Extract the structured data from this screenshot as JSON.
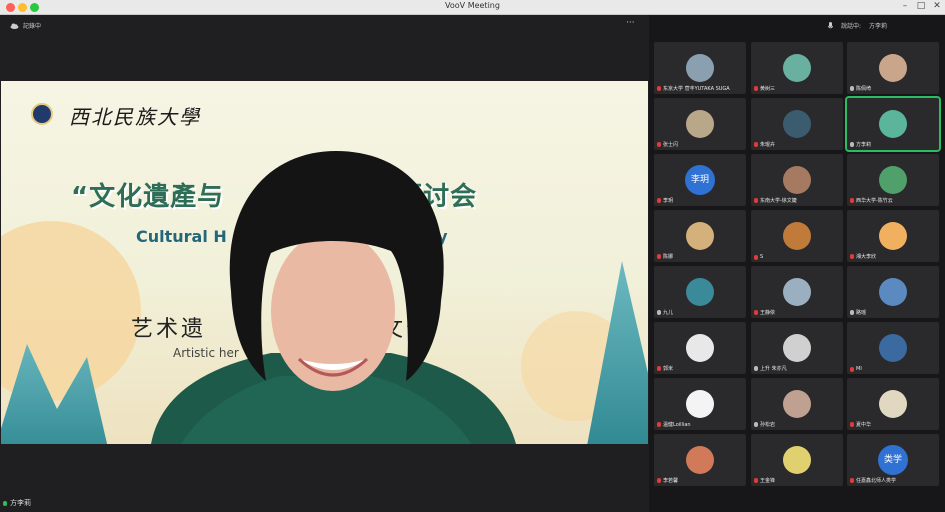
{
  "window": {
    "title": "VooV Meeting"
  },
  "toolbar": {
    "recording": "記錄中",
    "more": "···"
  },
  "sidebar_top": {
    "talking_label": "說話中:",
    "talking_name": "方李莉"
  },
  "slide": {
    "university": "西北民族大學",
    "title_cn": "“文化遺產与 　　　　学术研讨会",
    "title_en": "Cultural H　　　　　　　　　　pology",
    "subtitle_cn": "艺术遗　　　　　　　文化",
    "subtitle_en": "Artistic her"
  },
  "presenter_name": "方李莉",
  "participants": [
    {
      "name": "东京大学 菅丰YUTAKA SUGA",
      "avatar": "photo",
      "color": "#8aa0b0",
      "muted": true
    },
    {
      "name": "黄树三",
      "avatar": "photo",
      "color": "#6ab0a0",
      "muted": true
    },
    {
      "name": "陈佩绮",
      "avatar": "photo",
      "color": "#c9a58c",
      "muted": false
    },
    {
      "name": "张士闪",
      "avatar": "photo",
      "color": "#b9a78a",
      "muted": true
    },
    {
      "name": "朱琨卉",
      "avatar": "photo",
      "color": "#3b5c6e",
      "muted": true
    },
    {
      "name": "方李莉",
      "avatar": "photo",
      "color": "#5ab59a",
      "muted": false,
      "active": true
    },
    {
      "name": "李玥",
      "avatar": "text",
      "initials": "李玥",
      "color": "#2f72d3",
      "muted": true
    },
    {
      "name": "东南大学-徐文婕",
      "avatar": "photo",
      "color": "#a57a60",
      "muted": true
    },
    {
      "name": "西华大学-陈竹云",
      "avatar": "photo",
      "color": "#4fa06a",
      "muted": true
    },
    {
      "name": "陈娜",
      "avatar": "photo",
      "color": "#d4b07a",
      "muted": true
    },
    {
      "name": "S",
      "avatar": "photo",
      "color": "#c07a3a",
      "muted": true
    },
    {
      "name": "湘大李欣",
      "avatar": "photo",
      "color": "#f0b060",
      "muted": true
    },
    {
      "name": "九儿",
      "avatar": "photo",
      "color": "#3a8a9a",
      "muted": false
    },
    {
      "name": "王静依",
      "avatar": "photo",
      "color": "#9ab0c0",
      "muted": true
    },
    {
      "name": "路瑶",
      "avatar": "photo",
      "color": "#5a8ac0",
      "muted": false
    },
    {
      "name": "郭米",
      "avatar": "photo",
      "color": "#e8e8e8",
      "muted": true
    },
    {
      "name": "上升 朱亦凡",
      "avatar": "photo",
      "color": "#d0d0d0",
      "muted": false
    },
    {
      "name": "MI",
      "avatar": "photo",
      "color": "#3a6aa0",
      "muted": true
    },
    {
      "name": "温健Loillian",
      "avatar": "photo",
      "color": "#f4f4f4",
      "muted": true
    },
    {
      "name": "孙松岩",
      "avatar": "photo",
      "color": "#c0a090",
      "muted": false
    },
    {
      "name": "夏中华",
      "avatar": "photo",
      "color": "#e0d8c0",
      "muted": true
    },
    {
      "name": "李若馨",
      "avatar": "photo",
      "color": "#d07a5a",
      "muted": true
    },
    {
      "name": "王金锋",
      "avatar": "photo",
      "color": "#e0d070",
      "muted": true
    },
    {
      "name": "任嘉鑫北师人类学",
      "avatar": "text",
      "initials": "类学",
      "color": "#2f72d3",
      "muted": true
    }
  ]
}
